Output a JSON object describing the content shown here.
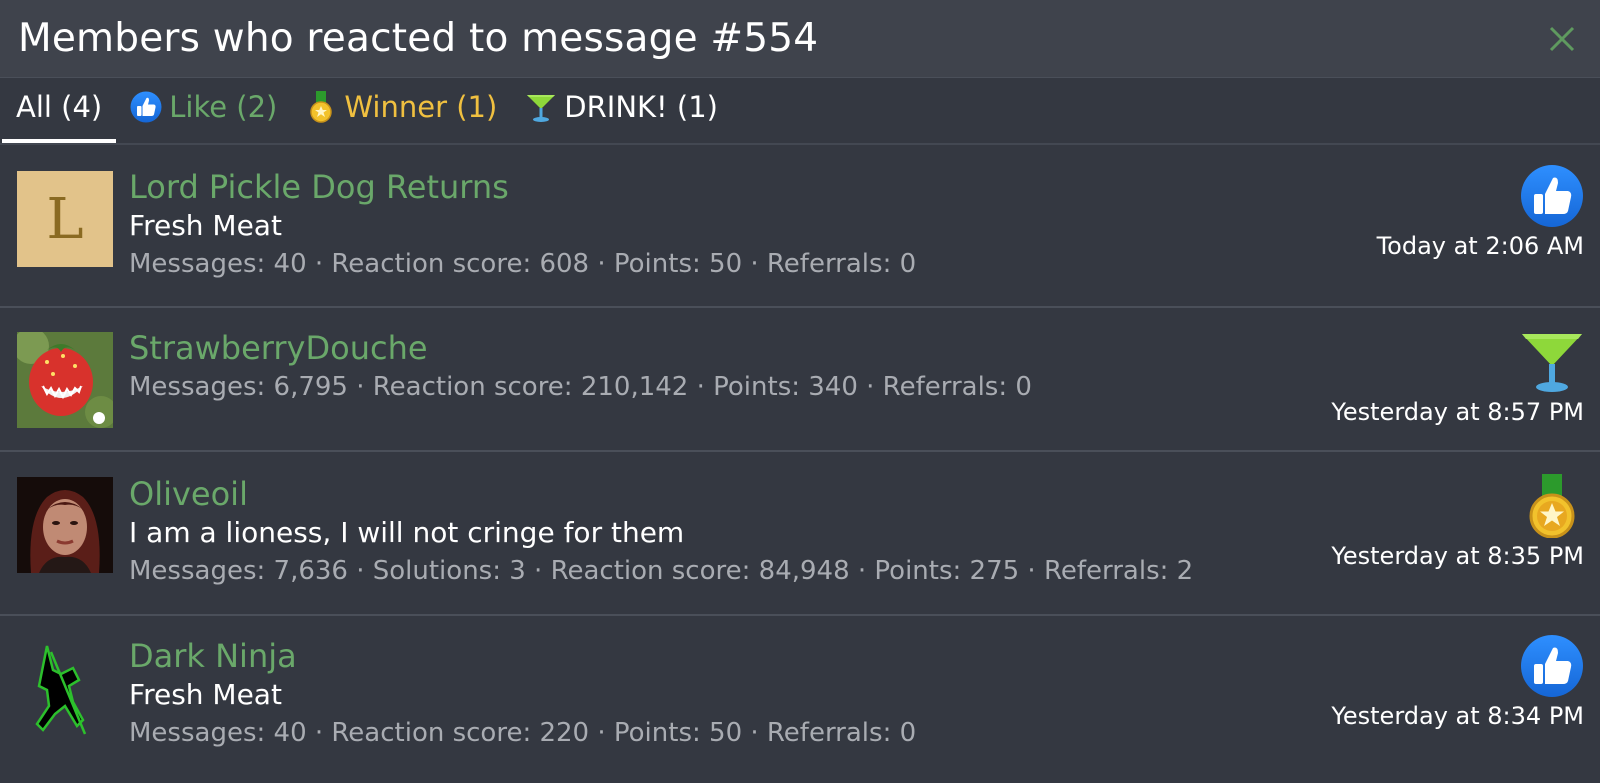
{
  "header": {
    "title": "Members who reacted to message #554"
  },
  "tabs": [
    {
      "label": "All (4)"
    },
    {
      "label": "Like (2)",
      "icon": "like-icon"
    },
    {
      "label": "Winner (1)",
      "icon": "medal-icon"
    },
    {
      "label": "DRINK! (1)",
      "icon": "cocktail-icon"
    }
  ],
  "rows": [
    {
      "name": "Lord Pickle Dog Returns",
      "avatar_letter": "L",
      "user_title": "Fresh Meat",
      "stats": "Messages: 40 · Reaction score: 608 · Points: 50 · Referrals: 0",
      "reaction": "like-icon",
      "date": "Today at 2:06 AM"
    },
    {
      "name": "StrawberryDouche",
      "stats": "Messages: 6,795 · Reaction score: 210,142 · Points: 340 · Referrals: 0",
      "reaction": "cocktail-icon",
      "date": "Yesterday at 8:57 PM"
    },
    {
      "name": "Oliveoil",
      "user_title": "I am a lioness, I will not cringe for them",
      "stats": "Messages: 7,636 · Solutions: 3 · Reaction score: 84,948 · Points: 275 · Referrals: 2",
      "reaction": "medal-icon",
      "date": "Yesterday at 8:35 PM"
    },
    {
      "name": "Dark Ninja",
      "user_title": "Fresh Meat",
      "stats": "Messages: 40 · Reaction score: 220 · Points: 50 · Referrals: 0",
      "reaction": "like-icon",
      "date": "Yesterday at 8:34 PM"
    }
  ],
  "colors": {
    "background": "#343841",
    "header": "#3f434c",
    "username": "#6aa86a",
    "winner": "#f0c040"
  }
}
